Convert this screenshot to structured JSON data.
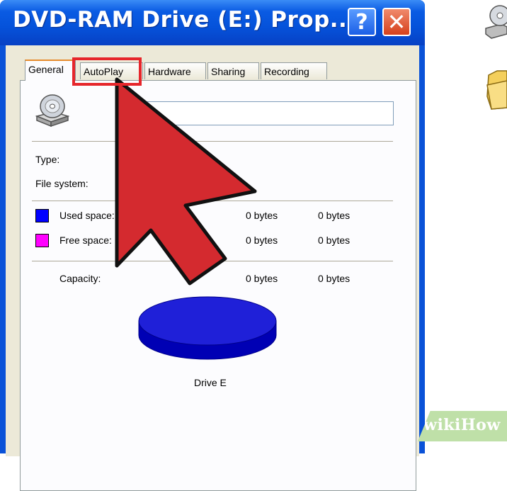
{
  "window": {
    "title": "DVD-RAM Drive (E:) Prop...",
    "help_label": "?",
    "close_label": "✕"
  },
  "tabs": [
    {
      "label": "General",
      "active": true
    },
    {
      "label": "AutoPlay",
      "active": false,
      "highlighted": true
    },
    {
      "label": "Hardware",
      "active": false
    },
    {
      "label": "Sharing",
      "active": false
    },
    {
      "label": "Recording",
      "active": false
    }
  ],
  "general": {
    "drive_icon": "cd-drive-icon",
    "name_value": "",
    "type_label": "Type:",
    "filesystem_label": "File system:",
    "used_label": "Used space:",
    "used_bytes": "0 bytes",
    "used_size": "0 bytes",
    "free_label": "Free space:",
    "free_bytes": "0 bytes",
    "free_size": "0 bytes",
    "capacity_label": "Capacity:",
    "capacity_bytes": "0 bytes",
    "capacity_size": "0 bytes",
    "drive_caption": "Drive E"
  },
  "colors": {
    "used": "#0000ff",
    "free": "#ff00ff",
    "arrow": "#d42a2f",
    "highlight": "#e6262b"
  },
  "annotation": {
    "arrow_icon": "pointer-arrow-icon"
  },
  "sidebar": {
    "items": [
      {
        "icon": "cd-drive-icon"
      },
      {
        "icon": "folder-icon"
      }
    ]
  },
  "watermark": {
    "text": "wikiHow"
  }
}
